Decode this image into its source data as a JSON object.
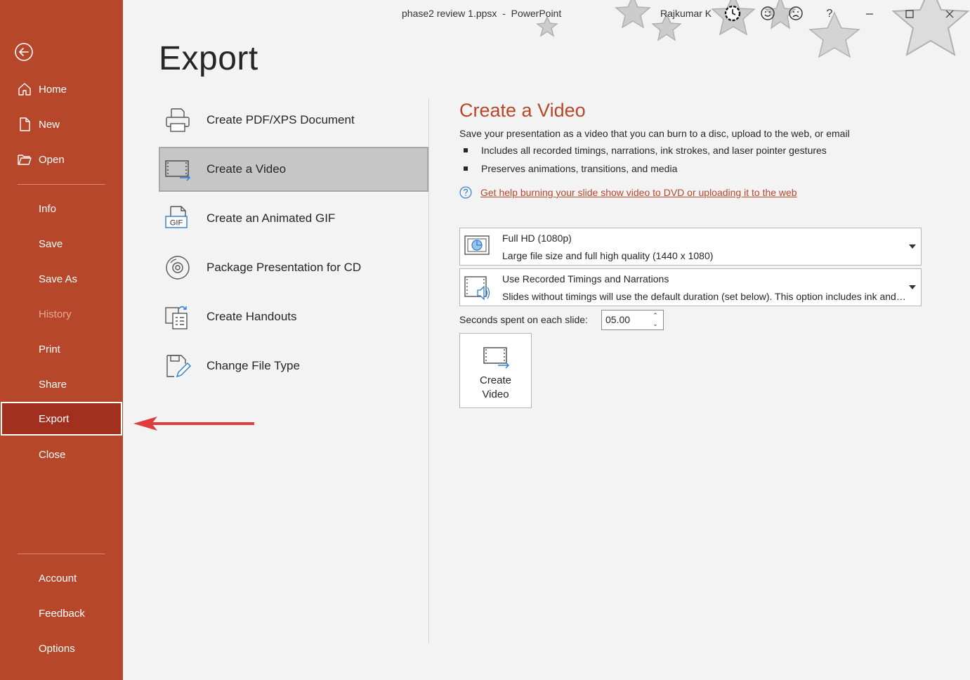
{
  "window": {
    "title": "phase2 review 1.ppsx  -  PowerPoint",
    "user": "Rajkumar K",
    "help_label": "?",
    "controls": [
      "minimize",
      "maximize",
      "close"
    ]
  },
  "nav": {
    "back_icon": "back-arrow-icon",
    "top_items": [
      {
        "label": "Home",
        "icon": "home-icon"
      },
      {
        "label": "New",
        "icon": "new-document-icon"
      },
      {
        "label": "Open",
        "icon": "open-folder-icon"
      }
    ],
    "middle_items": [
      {
        "label": "Info"
      },
      {
        "label": "Save"
      },
      {
        "label": "Save As"
      },
      {
        "label": "History",
        "disabled": true
      },
      {
        "label": "Print"
      },
      {
        "label": "Share"
      },
      {
        "label": "Export",
        "selected": true
      },
      {
        "label": "Close"
      }
    ],
    "bottom_items": [
      {
        "label": "Account"
      },
      {
        "label": "Feedback"
      },
      {
        "label": "Options"
      }
    ]
  },
  "page": {
    "heading": "Export"
  },
  "options": [
    {
      "label": "Create PDF/XPS Document",
      "icon": "pdf-printer-icon"
    },
    {
      "label": "Create a Video",
      "icon": "video-film-icon",
      "selected": true
    },
    {
      "label": "Create an Animated GIF",
      "icon": "gif-file-icon",
      "icon_text": "GIF"
    },
    {
      "label": "Package Presentation for CD",
      "icon": "cd-disc-icon"
    },
    {
      "label": "Create Handouts",
      "icon": "handouts-icon"
    },
    {
      "label": "Change File Type",
      "icon": "change-file-type-icon"
    }
  ],
  "video": {
    "title": "Create a Video",
    "description": "Save your presentation as a video that you can burn to a disc, upload to the web, or email",
    "bullets": [
      "Includes all recorded timings, narrations, ink strokes, and laser pointer gestures",
      "Preserves animations, transitions, and media"
    ],
    "help_link": "Get help burning your slide show video to DVD or uploading it to the web",
    "quality": {
      "title": "Full HD (1080p)",
      "subtitle": "Large file size and full high quality (1440 x 1080)",
      "icon": "monitor-quality-icon"
    },
    "timings": {
      "title": "Use Recorded Timings and Narrations",
      "subtitle": "Slides without timings will use the default duration (set below). This option includes ink and laser pointer gestures.",
      "icon": "narration-speaker-icon"
    },
    "seconds_label": "Seconds spent on each slide:",
    "seconds_value": "05.00",
    "create_button": {
      "line1": "Create",
      "line2": "Video"
    }
  },
  "colors": {
    "accent": "#b7472a",
    "nav_selected": "#a2301f",
    "annotation_arrow": "#e03c3c"
  }
}
